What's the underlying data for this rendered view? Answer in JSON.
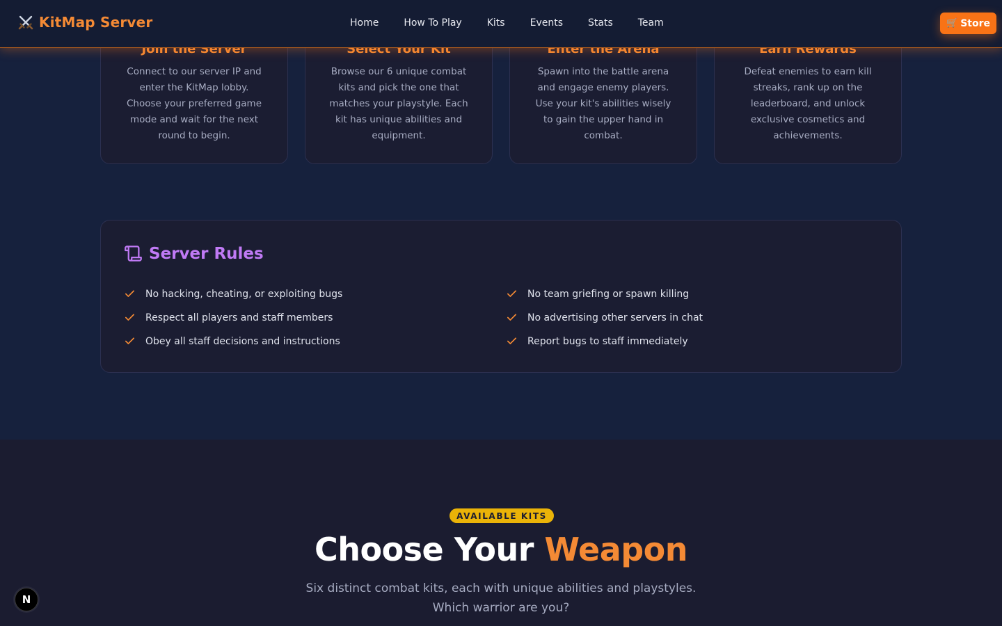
{
  "header": {
    "brand": "KitMap Server",
    "nav": [
      "Home",
      "How To Play",
      "Kits",
      "Events",
      "Stats",
      "Team"
    ],
    "store_label": "Store",
    "accent_color": "#f97316"
  },
  "steps": [
    {
      "title": "Join the Server",
      "description": "Connect to our server IP and enter the KitMap lobby. Choose your preferred game mode and wait for the next round to begin."
    },
    {
      "title": "Select Your Kit",
      "description": "Browse our 6 unique combat kits and pick the one that matches your playstyle. Each kit has unique abilities and equipment."
    },
    {
      "title": "Enter the Arena",
      "description": "Spawn into the battle arena and engage enemy players. Use your kit's abilities wisely to gain the upper hand in combat."
    },
    {
      "title": "Earn Rewards",
      "description": "Defeat enemies to earn kill streaks, rank up on the leaderboard, and unlock exclusive cosmetics and achievements."
    }
  ],
  "rules": {
    "title": "Server Rules",
    "items": [
      "No hacking, cheating, or exploiting bugs",
      "Respect all players and staff members",
      "Obey all staff decisions and instructions",
      "No team griefing or spawn killing",
      "No advertising other servers in chat",
      "Report bugs to staff immediately"
    ],
    "title_color": "#c07af5"
  },
  "kits_section": {
    "badge": "AVAILABLE KITS",
    "title_main": "Choose Your ",
    "title_accent": "Weapon",
    "subtitle": "Six distinct combat kits, each with unique abilities and playstyles. Which warrior are you?"
  },
  "floating_badge": "N"
}
